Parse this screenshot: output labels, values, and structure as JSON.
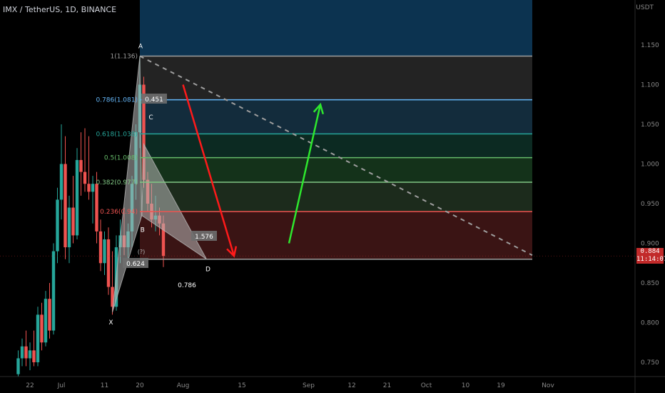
{
  "header": {
    "symbol": "IMX / TetherUS, 1D, BINANCE"
  },
  "price_axis": {
    "unit": "USDT",
    "current_price": "0.884",
    "countdown": "11:14:07"
  },
  "colors": {
    "background": "#000000",
    "up": "#26a69a",
    "down": "#ef5350",
    "pattern_fill": "#b8b8b8",
    "arrow_down": "#ff1a1a",
    "arrow_up": "#2ee82e",
    "badge": "#c22a2a"
  },
  "chart_data": {
    "type": "candlestick",
    "ylim": [
      0.725,
      1.225
    ],
    "y_ticks": [
      0.75,
      0.8,
      0.85,
      0.9,
      0.95,
      1.0,
      1.05,
      1.1,
      1.15
    ],
    "y_tick_labels": [
      "0.750",
      "0.800",
      "0.850",
      "0.900",
      "0.950",
      "1.000",
      "1.050",
      "1.100",
      "1.150"
    ],
    "x_ticks": [
      {
        "label": "22",
        "day": 22
      },
      {
        "label": "Jul",
        "day": 30
      },
      {
        "label": "11",
        "day": 41
      },
      {
        "label": "20",
        "day": 50
      },
      {
        "label": "Aug",
        "day": 61
      },
      {
        "label": "15",
        "day": 76
      },
      {
        "label": "Sep",
        "day": 93
      },
      {
        "label": "12",
        "day": 104
      },
      {
        "label": "21",
        "day": 113
      },
      {
        "label": "Oct",
        "day": 123
      },
      {
        "label": "10",
        "day": 133
      },
      {
        "label": "19",
        "day": 142
      },
      {
        "label": "Nov",
        "day": 154
      }
    ],
    "candles": [
      {
        "d": 19,
        "o": 0.735,
        "h": 0.765,
        "l": 0.725,
        "c": 0.755
      },
      {
        "d": 20,
        "o": 0.755,
        "h": 0.78,
        "l": 0.745,
        "c": 0.77
      },
      {
        "d": 21,
        "o": 0.77,
        "h": 0.79,
        "l": 0.745,
        "c": 0.755
      },
      {
        "d": 22,
        "o": 0.755,
        "h": 0.775,
        "l": 0.74,
        "c": 0.765
      },
      {
        "d": 23,
        "o": 0.765,
        "h": 0.79,
        "l": 0.745,
        "c": 0.75
      },
      {
        "d": 24,
        "o": 0.75,
        "h": 0.82,
        "l": 0.745,
        "c": 0.81
      },
      {
        "d": 25,
        "o": 0.81,
        "h": 0.825,
        "l": 0.765,
        "c": 0.775
      },
      {
        "d": 26,
        "o": 0.775,
        "h": 0.84,
        "l": 0.77,
        "c": 0.83
      },
      {
        "d": 27,
        "o": 0.83,
        "h": 0.85,
        "l": 0.78,
        "c": 0.79
      },
      {
        "d": 28,
        "o": 0.79,
        "h": 0.9,
        "l": 0.785,
        "c": 0.89
      },
      {
        "d": 29,
        "o": 0.89,
        "h": 0.97,
        "l": 0.875,
        "c": 0.955
      },
      {
        "d": 30,
        "o": 0.955,
        "h": 1.05,
        "l": 0.93,
        "c": 1.0
      },
      {
        "d": 31,
        "o": 1.0,
        "h": 1.035,
        "l": 0.88,
        "c": 0.895
      },
      {
        "d": 32,
        "o": 0.895,
        "h": 0.96,
        "l": 0.875,
        "c": 0.945
      },
      {
        "d": 33,
        "o": 0.945,
        "h": 0.985,
        "l": 0.9,
        "c": 0.91
      },
      {
        "d": 34,
        "o": 0.91,
        "h": 1.02,
        "l": 0.905,
        "c": 1.005
      },
      {
        "d": 35,
        "o": 1.005,
        "h": 1.04,
        "l": 0.96,
        "c": 0.99
      },
      {
        "d": 36,
        "o": 0.99,
        "h": 1.045,
        "l": 0.965,
        "c": 0.975
      },
      {
        "d": 37,
        "o": 0.975,
        "h": 1.035,
        "l": 0.955,
        "c": 0.965
      },
      {
        "d": 38,
        "o": 0.965,
        "h": 0.985,
        "l": 0.925,
        "c": 0.975
      },
      {
        "d": 39,
        "o": 0.975,
        "h": 0.99,
        "l": 0.9,
        "c": 0.915
      },
      {
        "d": 40,
        "o": 0.915,
        "h": 0.93,
        "l": 0.865,
        "c": 0.875
      },
      {
        "d": 41,
        "o": 0.875,
        "h": 0.915,
        "l": 0.86,
        "c": 0.905
      },
      {
        "d": 42,
        "o": 0.905,
        "h": 0.92,
        "l": 0.835,
        "c": 0.845
      },
      {
        "d": 43,
        "o": 0.845,
        "h": 0.89,
        "l": 0.81,
        "c": 0.82
      },
      {
        "d": 44,
        "o": 0.82,
        "h": 0.91,
        "l": 0.815,
        "c": 0.895
      },
      {
        "d": 45,
        "o": 0.895,
        "h": 0.93,
        "l": 0.875,
        "c": 0.91
      },
      {
        "d": 46,
        "o": 0.91,
        "h": 0.945,
        "l": 0.885,
        "c": 0.895
      },
      {
        "d": 47,
        "o": 0.895,
        "h": 0.925,
        "l": 0.87,
        "c": 0.915
      },
      {
        "d": 48,
        "o": 0.915,
        "h": 0.985,
        "l": 0.895,
        "c": 0.975
      },
      {
        "d": 49,
        "o": 0.975,
        "h": 1.05,
        "l": 0.955,
        "c": 1.04
      },
      {
        "d": 50,
        "o": 1.04,
        "h": 1.136,
        "l": 1.02,
        "c": 1.1
      },
      {
        "d": 51,
        "o": 1.1,
        "h": 1.11,
        "l": 0.97,
        "c": 0.98
      },
      {
        "d": 52,
        "o": 0.98,
        "h": 0.99,
        "l": 0.94,
        "c": 0.95
      },
      {
        "d": 53,
        "o": 0.95,
        "h": 0.975,
        "l": 0.92,
        "c": 0.93
      },
      {
        "d": 54,
        "o": 0.93,
        "h": 0.96,
        "l": 0.915,
        "c": 0.935
      },
      {
        "d": 55,
        "o": 0.935,
        "h": 0.945,
        "l": 0.91,
        "c": 0.925
      },
      {
        "d": 56,
        "o": 0.925,
        "h": 0.935,
        "l": 0.87,
        "c": 0.884
      }
    ],
    "fib_levels": [
      {
        "label": "1(1.136)",
        "value": 1.136,
        "color": "#9e9e9e"
      },
      {
        "label": "0.786(1.081)",
        "value": 1.081,
        "color": "#64b5f6"
      },
      {
        "label": "0.618(1.038)",
        "value": 1.038,
        "color": "#26a69a"
      },
      {
        "label": "0.5(1.008)",
        "value": 1.008,
        "color": "#66bb6a"
      },
      {
        "label": "0.382(0.977)",
        "value": 0.977,
        "color": "#81c784"
      },
      {
        "label": "0.236(0.94)",
        "value": 0.94,
        "color": "#ef5350"
      },
      {
        "label": "",
        "value": 0.88,
        "color": "#9e9e9e"
      }
    ],
    "fib_zones": [
      {
        "from": 1.136,
        "to": 1.225,
        "color": "#0c3350"
      },
      {
        "from": 1.081,
        "to": 1.136,
        "color": "#232323"
      },
      {
        "from": 1.038,
        "to": 1.081,
        "color": "#132c3c"
      },
      {
        "from": 1.008,
        "to": 1.038,
        "color": "#0c2a22"
      },
      {
        "from": 0.977,
        "to": 1.008,
        "color": "#14321a"
      },
      {
        "from": 0.94,
        "to": 0.977,
        "color": "#1c2b1c"
      },
      {
        "from": 0.88,
        "to": 0.94,
        "color": "#3a1414"
      }
    ],
    "fib_range": {
      "start_day": 50,
      "end_day": 150
    },
    "pattern": {
      "X": {
        "day": 43,
        "value": 0.813
      },
      "A": {
        "day": 50,
        "value": 1.136
      },
      "B": {
        "day": 50.5,
        "value": 0.935
      },
      "C": {
        "day": 51,
        "value": 1.025
      },
      "D": {
        "day": 67,
        "value": 0.88
      },
      "labels": {
        "X": "X",
        "A": "A",
        "B": "B",
        "C": "C",
        "D": "D"
      },
      "ratio_XB": "0.624",
      "ratio_AC": "0.451",
      "ratio_BD": "1.576",
      "ratio_XD": "0.786",
      "ratio_small": "(?)"
    },
    "trend_line": {
      "from": {
        "day": 50,
        "value": 1.136
      },
      "to": {
        "day": 150,
        "value": 0.885
      }
    },
    "arrows": [
      {
        "name": "down-arrow",
        "from": {
          "day": 61,
          "value": 1.1
        },
        "to": {
          "day": 74,
          "value": 0.884
        }
      },
      {
        "name": "up-arrow",
        "from": {
          "day": 88,
          "value": 0.9
        },
        "to": {
          "day": 96,
          "value": 1.075
        }
      }
    ]
  }
}
